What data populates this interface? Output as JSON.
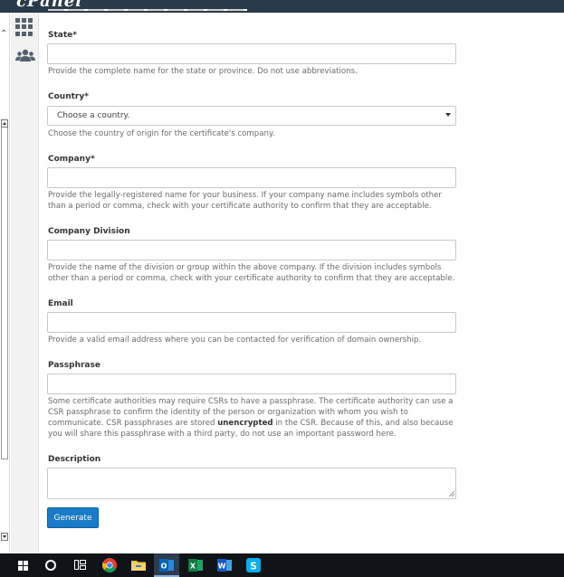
{
  "header": {
    "logo_text": "cPanel"
  },
  "sidebar": {
    "items": [
      {
        "icon": "grid-icon"
      },
      {
        "icon": "users-icon"
      }
    ]
  },
  "form": {
    "state": {
      "label": "State*",
      "value": "",
      "help": "Provide the complete name for the state or province. Do not use abbreviations."
    },
    "country": {
      "label": "Country*",
      "selected": "Choose a country.",
      "help": "Choose the country of origin for the certificate's company."
    },
    "company": {
      "label": "Company*",
      "value": "",
      "help": "Provide the legally-registered name for your business. If your company name includes symbols other than a period or comma, check with your certificate authority to confirm that they are acceptable."
    },
    "division": {
      "label": "Company Division",
      "value": "",
      "help": "Provide the name of the division or group within the above company. If the division includes symbols other than a period or comma, check with your certificate authority to confirm that they are acceptable."
    },
    "email": {
      "label": "Email",
      "value": "",
      "help": "Provide a valid email address where you can be contacted for verification of domain ownership."
    },
    "passphrase": {
      "label": "Passphrase",
      "value": "",
      "help_pre": "Some certificate authorities may require CSRs to have a passphrase. The certificate authority can use a CSR passphrase to confirm the identity of the person or organization with whom you wish to communicate. CSR passphrases are stored ",
      "help_bold": "unencrypted",
      "help_post": " in the CSR. Because of this, and also because you will share this passphrase with a third party, do not use an important password here."
    },
    "description": {
      "label": "Description",
      "value": ""
    },
    "generate_label": "Generate"
  },
  "taskbar": {
    "apps": [
      {
        "icon": "chrome-icon"
      },
      {
        "icon": "file-explorer-icon"
      },
      {
        "icon": "outlook-icon",
        "active": true
      },
      {
        "icon": "excel-icon"
      },
      {
        "icon": "word-icon"
      },
      {
        "icon": "skype-icon"
      }
    ]
  },
  "colors": {
    "header_bg": "#293a4a",
    "accent": "#1a7cc8",
    "taskbar_bg": "#101418"
  }
}
